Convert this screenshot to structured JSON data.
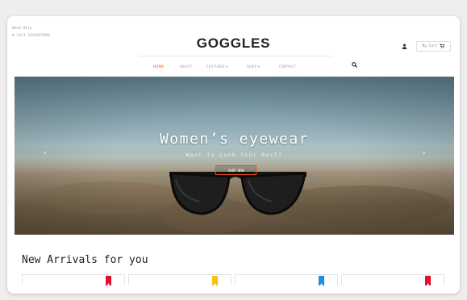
{
  "header": {
    "contact_label": "Need Help",
    "phone": "Call 1234567890",
    "logo": "GOGGLES",
    "cart_label": "My Cart"
  },
  "nav": {
    "items": [
      {
        "label": "HOME",
        "active": true
      },
      {
        "label": "ABOUT",
        "active": false
      },
      {
        "label": "FEATURES ▾",
        "active": false
      },
      {
        "label": "SHOP ▾",
        "active": false
      },
      {
        "label": "CONTACT",
        "active": false
      }
    ]
  },
  "hero": {
    "title": "Women’s eyewear",
    "subtitle": "Want to Look Your Best?",
    "button": "SHOP NOW",
    "prev_arrow": "‹",
    "next_arrow": "›"
  },
  "arrivals": {
    "title": "New Arrivals for you",
    "tag_colors": [
      "#e3102b",
      "#f3c316",
      "#1f8ee0",
      "#e3102b"
    ]
  },
  "colors": {
    "accent": "#e94e1b"
  },
  "icons": {
    "phone": "phone-icon",
    "user": "user-icon",
    "cart": "cart-icon",
    "search": "search-icon"
  }
}
